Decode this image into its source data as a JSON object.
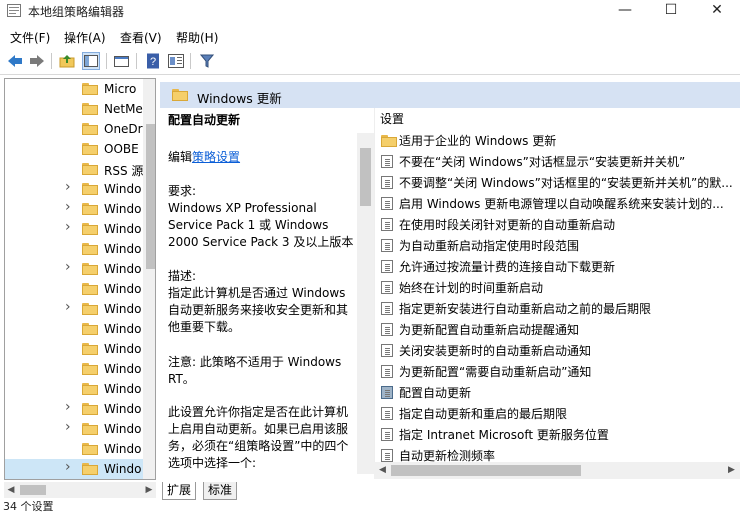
{
  "window": {
    "title": "本地组策略编辑器",
    "controls": [
      "—",
      "☐",
      "✕"
    ]
  },
  "menu": [
    "文件(F)",
    "操作(A)",
    "查看(V)",
    "帮助(H)"
  ],
  "tree": {
    "items": [
      {
        "label": "Micro",
        "expandable": false
      },
      {
        "label": "NetMe",
        "expandable": false
      },
      {
        "label": "OneDr",
        "expandable": false
      },
      {
        "label": "OOBE",
        "expandable": false
      },
      {
        "label": "RSS 源",
        "expandable": false
      },
      {
        "label": "Windo",
        "expandable": true
      },
      {
        "label": "Windo",
        "expandable": true
      },
      {
        "label": "Windo",
        "expandable": true
      },
      {
        "label": "Windo",
        "expandable": false
      },
      {
        "label": "Windo",
        "expandable": true
      },
      {
        "label": "Windo",
        "expandable": false
      },
      {
        "label": "Windo",
        "expandable": true
      },
      {
        "label": "Windo",
        "expandable": false
      },
      {
        "label": "Windo",
        "expandable": false
      },
      {
        "label": "Windo",
        "expandable": false
      },
      {
        "label": "Windo",
        "expandable": false
      },
      {
        "label": "Windo",
        "expandable": true
      },
      {
        "label": "Windo",
        "expandable": true
      },
      {
        "label": "Windo",
        "expandable": false
      },
      {
        "label": "Windo",
        "expandable": true
      }
    ]
  },
  "content": {
    "header": "Windows 更新",
    "desc": {
      "title": "配置自动更新",
      "edit_prefix": "编辑",
      "edit_link": "策略设置",
      "req_label": "要求:",
      "req_text": "Windows XP Professional Service Pack 1 或 Windows 2000 Service Pack 3 及以上版本",
      "desc_label": "描述:",
      "desc_text": "指定此计算机是否通过 Windows 自动更新服务来接收安全更新和其他重要下载。",
      "note": "注意: 此策略不适用于 Windows RT。",
      "more": "此设置允许你指定是否在此计算机上启用自动更新。如果已启用该服务，必须在“组策略设置”中的四个选项中选择一个:"
    },
    "list_header": "设置",
    "list": [
      {
        "label": "适用于企业的 Windows 更新",
        "type": "folder"
      },
      {
        "label": "不要在“关闭 Windows”对话框显示“安装更新并关机”",
        "type": "doc"
      },
      {
        "label": "不要调整“关闭 Windows”对话框里的“安装更新并关机”的默...",
        "type": "doc"
      },
      {
        "label": "启用 Windows 更新电源管理以自动唤醒系统来安装计划的...",
        "type": "doc"
      },
      {
        "label": "在使用时段关闭针对更新的自动重新启动",
        "type": "doc"
      },
      {
        "label": "为自动重新启动指定使用时段范围",
        "type": "doc"
      },
      {
        "label": "允许通过按流量计费的连接自动下载更新",
        "type": "doc"
      },
      {
        "label": "始终在计划的时间重新启动",
        "type": "doc"
      },
      {
        "label": "指定更新安装进行自动重新启动之前的最后期限",
        "type": "doc"
      },
      {
        "label": "为更新配置自动重新启动提醒通知",
        "type": "doc"
      },
      {
        "label": "关闭安装更新时的自动重新启动通知",
        "type": "doc"
      },
      {
        "label": "为更新配置“需要自动重新启动”通知",
        "type": "doc"
      },
      {
        "label": "配置自动更新",
        "type": "doc-active"
      },
      {
        "label": "指定自动更新和重启的最后期限",
        "type": "doc"
      },
      {
        "label": "指定 Intranet Microsoft 更新服务位置",
        "type": "doc"
      },
      {
        "label": "自动更新检测频率",
        "type": "doc"
      }
    ],
    "tabs": [
      "扩展",
      "标准"
    ]
  },
  "status": "34 个设置"
}
